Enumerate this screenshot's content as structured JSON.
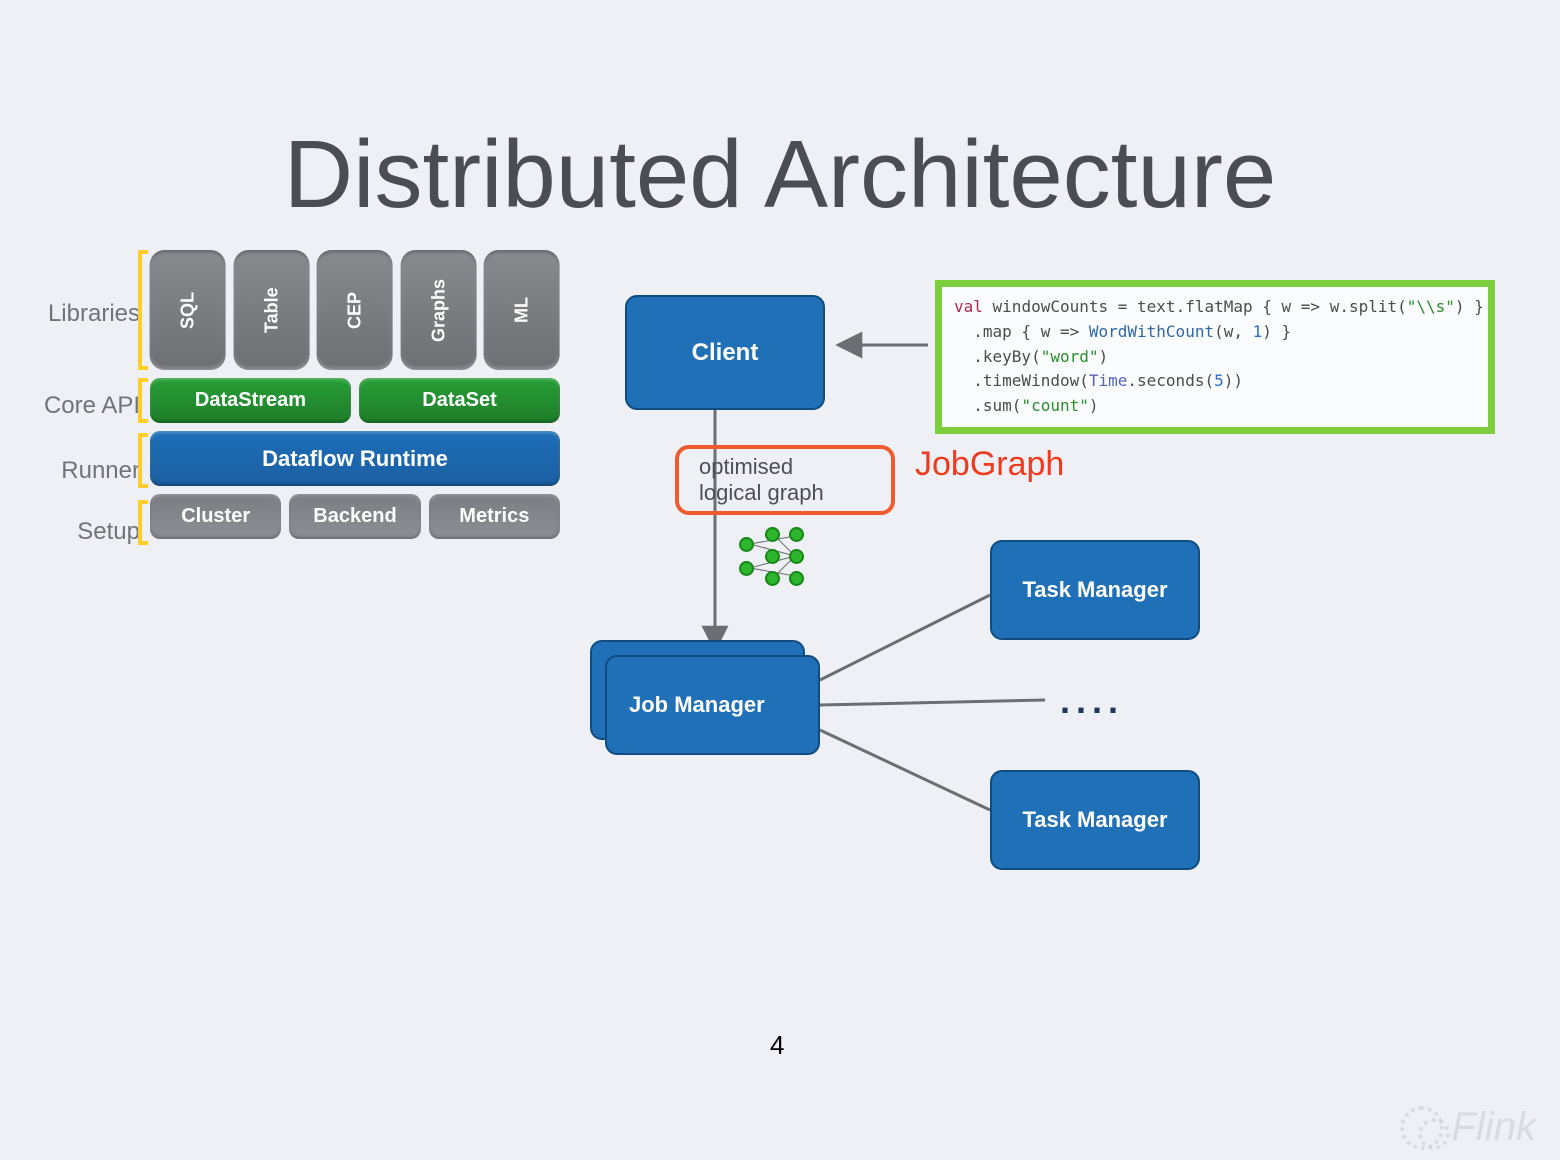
{
  "title": "Distributed Architecture",
  "page_number": "4",
  "watermark": "Flink",
  "stack": {
    "labels": {
      "libraries": "Libraries",
      "core_api": "Core API",
      "runner": "Runner",
      "setup": "Setup"
    },
    "libs": [
      "SQL",
      "Table",
      "CEP",
      "Graphs",
      "ML"
    ],
    "core": [
      "DataStream",
      "DataSet"
    ],
    "runner": "Dataflow Runtime",
    "setup": [
      "Cluster",
      "Backend",
      "Metrics"
    ]
  },
  "diagram": {
    "client": "Client",
    "job_manager": "Job Manager",
    "task_manager": "Task Manager",
    "ellipsis": "....",
    "opt_line1": "optimised",
    "opt_line2": "logical graph",
    "jobgraph": "JobGraph"
  },
  "code": {
    "l1_pre": "val",
    "l1_var": " windowCounts ",
    "l1_eq": "= text.flatMap { w => w.split(",
    "l1_str": "\"\\\\s\"",
    "l1_post": ") }",
    "l2_pre": "  .map { w => ",
    "l2_fn": "WordWithCount",
    "l2_mid": "(w, ",
    "l2_num": "1",
    "l2_post": ") }",
    "l3_pre": "  .keyBy(",
    "l3_str": "\"word\"",
    "l3_post": ")",
    "l4_pre": "  .timeWindow(",
    "l4_type": "Time",
    "l4_mid": ".seconds(",
    "l4_num": "5",
    "l4_post": "))",
    "l5_pre": "  .sum(",
    "l5_str": "\"count\"",
    "l5_post": ")"
  }
}
